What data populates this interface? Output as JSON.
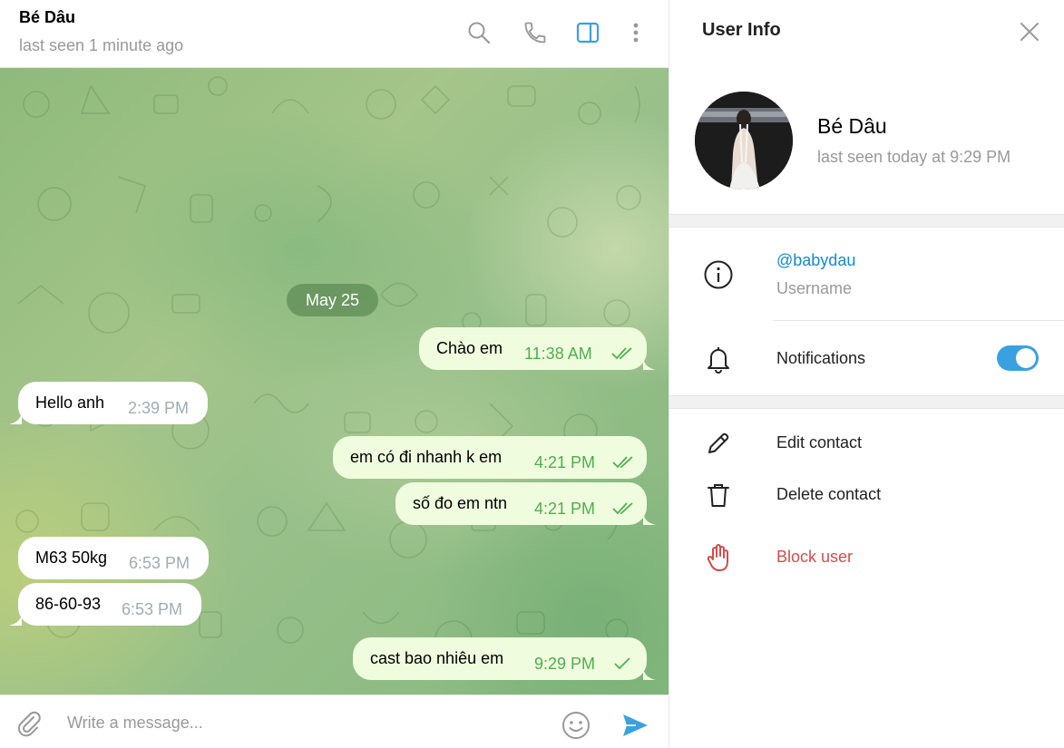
{
  "chat": {
    "title": "Bé Dâu",
    "status": "last seen 1 minute ago",
    "date_separator": "May 25",
    "composer_placeholder": "Write a message...",
    "messages": [
      {
        "text": "Chào em",
        "time": "11:38 AM",
        "direction": "out",
        "read": true
      },
      {
        "text": "Hello anh",
        "time": "2:39 PM",
        "direction": "in"
      },
      {
        "text": "em có đi nhanh k em",
        "time": "4:21 PM",
        "direction": "out",
        "read": true
      },
      {
        "text": "số đo em ntn",
        "time": "4:21 PM",
        "direction": "out",
        "read": true
      },
      {
        "text": "M63 50kg",
        "time": "6:53 PM",
        "direction": "in"
      },
      {
        "text": "86-60-93",
        "time": "6:53 PM",
        "direction": "in"
      },
      {
        "text": "cast bao nhiêu em",
        "time": "9:29 PM",
        "direction": "out",
        "read": false
      }
    ]
  },
  "header_icons": [
    "search-icon",
    "phone-icon",
    "sidebar-toggle-icon",
    "more-vertical-icon"
  ],
  "panel": {
    "title": "User Info",
    "name": "Bé Dâu",
    "status": "last seen today at 9:29 PM",
    "username": "@babydau",
    "username_label": "Username",
    "notifications_label": "Notifications",
    "notifications_enabled": true,
    "actions": [
      {
        "label": "Edit contact",
        "icon": "pencil-icon"
      },
      {
        "label": "Delete contact",
        "icon": "trash-icon"
      },
      {
        "label": "Block user",
        "icon": "hand-stop-icon"
      }
    ]
  },
  "colors": {
    "accent": "#3aa1e0",
    "link": "#168acd",
    "outgoing_bubble": "#effdde",
    "outgoing_time": "#4fae4e",
    "danger": "#d14e4e"
  }
}
